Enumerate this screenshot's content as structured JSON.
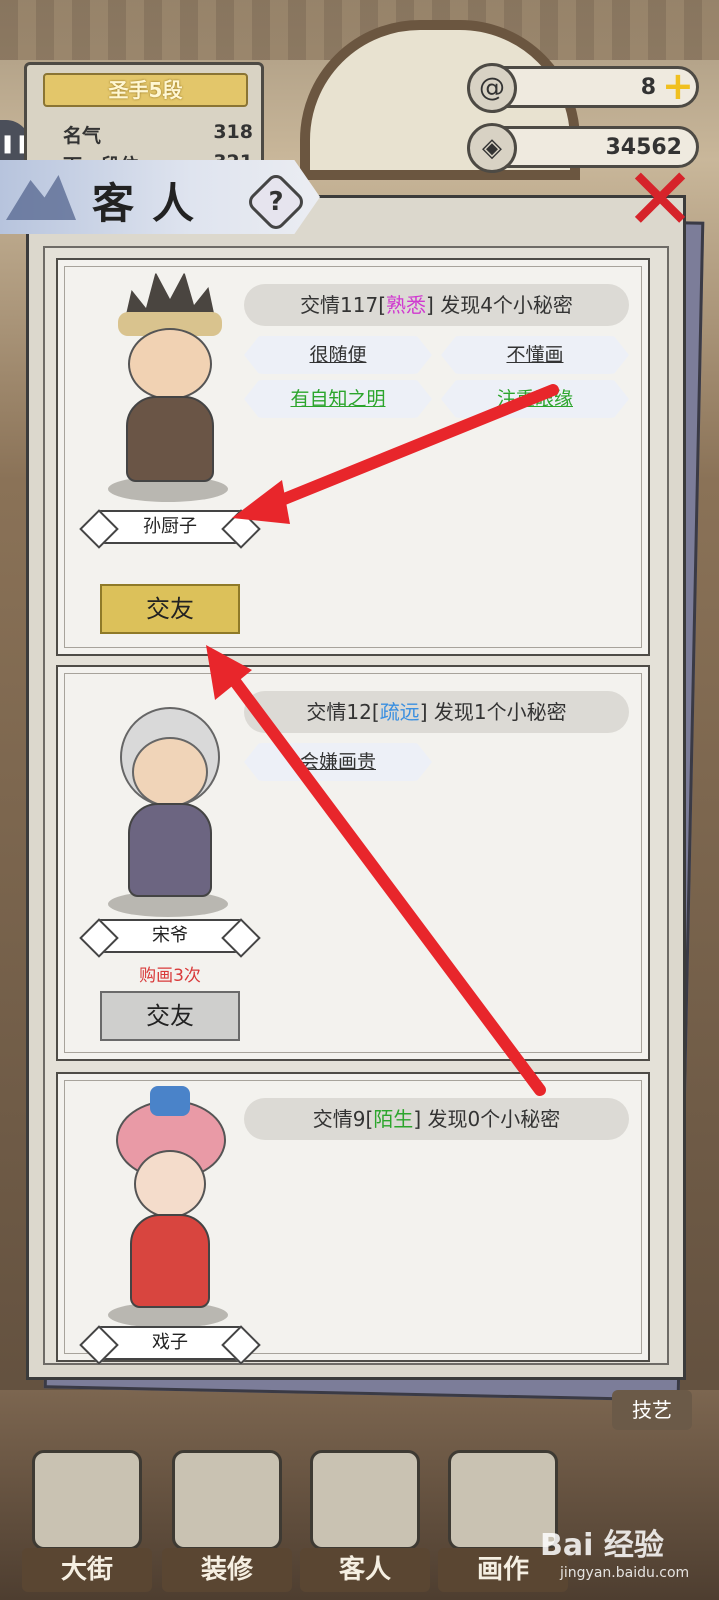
{
  "hud": {
    "rank": "圣手5段",
    "fame_label": "名气",
    "fame_value": "318",
    "next_label": "下一段位",
    "next_value": "321",
    "tokens": "8",
    "coins": "34562",
    "plus": "+"
  },
  "panel": {
    "title": "客人",
    "help": "?",
    "close": "✕"
  },
  "guests": [
    {
      "intimacy_prefix": "交情117[",
      "intimacy_level": "熟悉",
      "intimacy_suffix": "] 发现4个小秘密",
      "level_color": "#d03ad0",
      "traits": [
        "很随便",
        "不懂画",
        "有自知之明",
        "注重眼缘"
      ],
      "name": "孙厨子",
      "button": "交友",
      "button_style": "gold"
    },
    {
      "intimacy_prefix": "交情12[",
      "intimacy_level": "疏远",
      "intimacy_suffix": "] 发现1个小秘密",
      "level_color": "#3a8fe0",
      "traits": [
        "会嫌画贵"
      ],
      "name": "宋爷",
      "bought": "购画3次",
      "button": "交友",
      "button_style": "grey"
    },
    {
      "intimacy_prefix": "交情9[",
      "intimacy_level": "陌生",
      "intimacy_suffix": "] 发现0个小秘密",
      "level_color": "#2ca52c",
      "traits": [],
      "name": "戏子"
    }
  ],
  "nav": {
    "street": "大街",
    "decor": "装修",
    "guests": "客人",
    "paint": "画作",
    "craft": "技艺"
  },
  "watermark": {
    "brand": "Bai 经验",
    "url": "jingyan.baidu.com"
  },
  "colors": {
    "arrow": "#e8262b",
    "gold_button": "#dcc15a",
    "trait_green": "#2ca52c"
  }
}
